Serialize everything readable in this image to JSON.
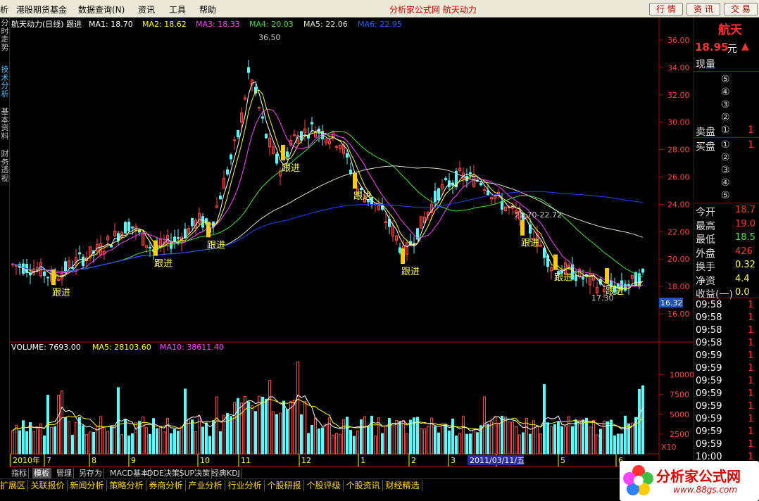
{
  "menu": {
    "items": [
      "析",
      "港股期货基金",
      "数据查询(N)",
      "资讯",
      "工具",
      "帮助"
    ],
    "title": "分析家公式网 航天动力",
    "buttons": [
      "行 情",
      "资 讯",
      "交 易"
    ]
  },
  "left_tabs": [
    "分时走势",
    "技术分析",
    "基本资料",
    "财务透视"
  ],
  "header": {
    "stock": "航天动力(日线) 跟进",
    "ma1": "MA1: 18.70",
    "ma2": "MA2: 18.62",
    "ma3": "MA3: 18.33",
    "ma4": "MA4: 20.03",
    "ma5": "MA5: 22.06",
    "ma6": "MA6: 22.95"
  },
  "volume_header": {
    "vol": "VOLUME: 7693.00",
    "ma5": "MA5: 28103.60",
    "ma10": "MA10: 38611.40"
  },
  "colors": {
    "up": "#ff4040",
    "down": "#54ffff",
    "ma1": "#ffffff",
    "ma2": "#ffff00",
    "ma3": "#ff40ff",
    "ma4": "#40e040",
    "ma5": "#e0e0c8",
    "ma6": "#2040ff",
    "axis": "#b40000",
    "signal": "#ffff40",
    "price_tag_bg": "#2050c0"
  },
  "chart_data": {
    "type": "candlestick",
    "title": "航天动力(日线)",
    "ylim": [
      15.5,
      37.0
    ],
    "y_ticks": [
      16.0,
      18.0,
      20.0,
      22.0,
      24.0,
      26.0,
      28.0,
      30.0,
      32.0,
      34.0,
      36.0
    ],
    "x_ticks": [
      "2010年",
      "7",
      "8",
      "9",
      "10",
      "11",
      "12",
      "1",
      "2",
      "3",
      "4",
      "5",
      "6"
    ],
    "date_marker": "2011/03/11/五",
    "annotations": {
      "high": "36.50",
      "low": "17.30",
      "range": "22.70-22.72",
      "current": "16.32"
    },
    "signal_label": "跟进",
    "signal_count": 9,
    "volume_ticks": [
      "10000",
      "7500",
      "5000",
      "2500"
    ],
    "volume_scale": "X10"
  },
  "right_panel": {
    "name": "航天",
    "price": "18.95",
    "unit": "元",
    "arrow": "▲",
    "now_label": "现量",
    "sell_label": "卖盘",
    "buy_label": "买盘",
    "sell_levels": [
      "⑤",
      "④",
      "③",
      "②",
      "①"
    ],
    "buy_levels": [
      "①",
      "②",
      "③",
      "④",
      "⑤"
    ],
    "sell1_val": "1",
    "buy1_val": "1",
    "stats": [
      {
        "label": "今开",
        "value": "18.7"
      },
      {
        "label": "最高",
        "value": "19.0"
      },
      {
        "label": "最低",
        "value": "18.5"
      },
      {
        "label": "外盘",
        "value": "426"
      },
      {
        "label": "换手",
        "value": "0.32"
      },
      {
        "label": "净资",
        "value": "4.4"
      },
      {
        "label": "收益(一)",
        "value": "0.0"
      }
    ],
    "ticks": [
      "09:58",
      "09:58",
      "09:58",
      "09:58",
      "09:59",
      "09:59",
      "09:59",
      "09:59",
      "09:59",
      "09:59",
      "09:59",
      "09:59",
      "10:00",
      "10:00"
    ]
  },
  "bottom_tabs": [
    "指标",
    "模板",
    "管理",
    "另存为",
    "MACD基本",
    "DDE决策",
    "SUP决策",
    "经典KDJ"
  ],
  "function_bar": [
    "扩展区",
    "关联报价",
    "新闻分析",
    "策略分析",
    "券商分析",
    "产业分析",
    "行业分析",
    "个股研报",
    "个股评级",
    "个股资讯",
    "财经精选"
  ],
  "watermark": {
    "text": "分析家公式网",
    "url": "www.88gs.com"
  }
}
